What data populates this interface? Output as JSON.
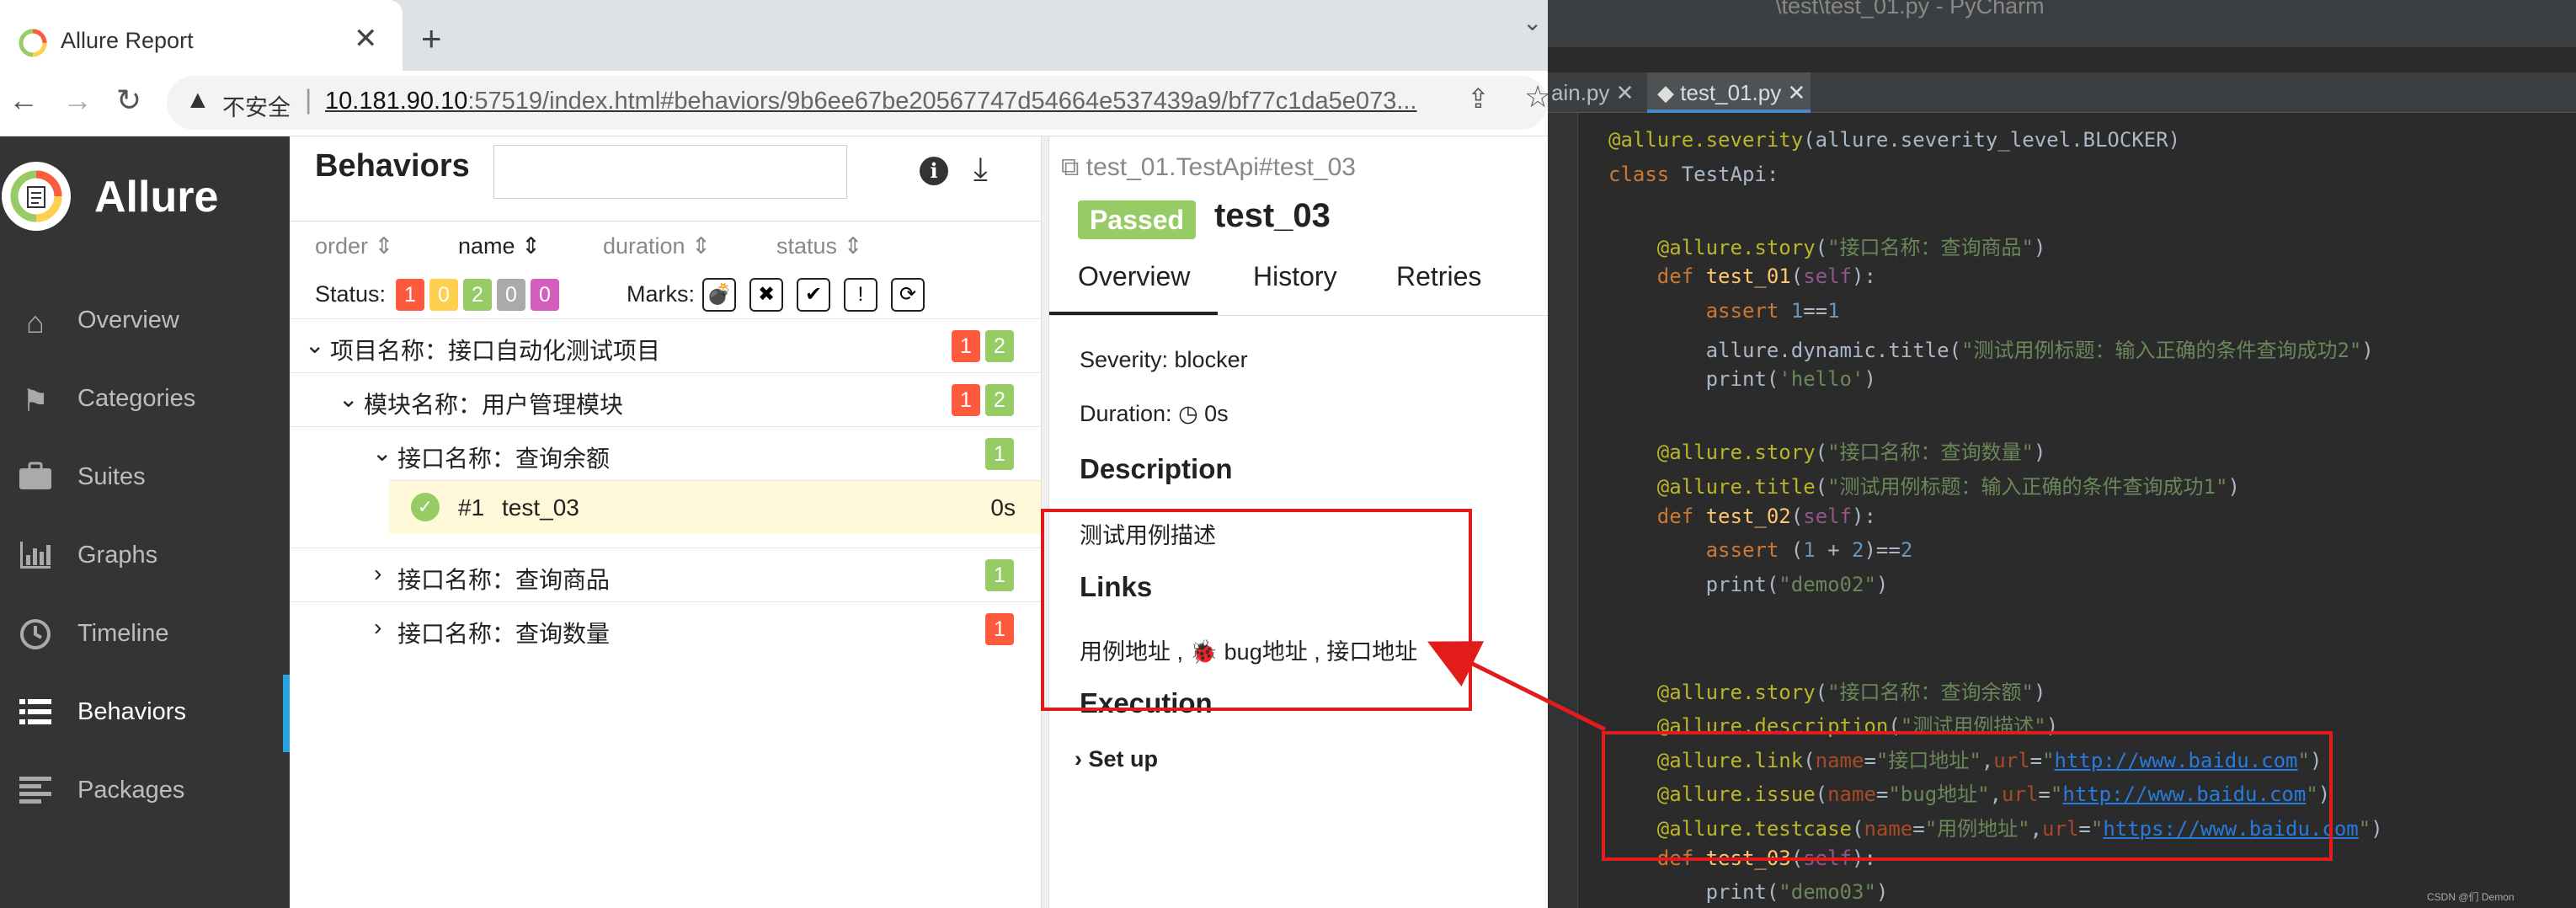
{
  "browser": {
    "tab_title": "Allure Report",
    "tab_close": "✕",
    "new_tab": "+",
    "insecure_label": "不安全",
    "url_host": "10.181.90.10",
    "url_rest": ":57519/index.html#behaviors/9b6ee67be20567747d54664e537439a9/bf77c1da5e073...",
    "win_min": "—",
    "win_max": "☐",
    "win_close": "✕",
    "win_more": "⌄"
  },
  "sidebar": {
    "brand": "Allure",
    "items": [
      {
        "label": "Overview",
        "icon": "home-icon"
      },
      {
        "label": "Categories",
        "icon": "flag-icon"
      },
      {
        "label": "Suites",
        "icon": "briefcase-icon"
      },
      {
        "label": "Graphs",
        "icon": "bar-chart-icon"
      },
      {
        "label": "Timeline",
        "icon": "clock-icon"
      },
      {
        "label": "Behaviors",
        "icon": "list-icon",
        "active": true
      },
      {
        "label": "Packages",
        "icon": "align-left-icon"
      }
    ]
  },
  "behaviors": {
    "title": "Behaviors",
    "search_placeholder": "",
    "sort_columns": [
      "order",
      "name",
      "duration",
      "status"
    ],
    "status_label": "Status:",
    "status_counts": [
      {
        "value": "1",
        "color": "#fd5a3e"
      },
      {
        "value": "0",
        "color": "#ffd050"
      },
      {
        "value": "2",
        "color": "#97cc64"
      },
      {
        "value": "0",
        "color": "#aaaaaa"
      },
      {
        "value": "0",
        "color": "#d35ebe"
      }
    ],
    "marks_label": "Marks:",
    "marks": [
      "💣",
      "✖",
      "✔",
      "!",
      "⟳"
    ],
    "tree": [
      {
        "label": "项目名称：接口自动化测试项目",
        "expanded": true,
        "counts": [
          "1",
          "2"
        ]
      },
      {
        "label": "模块名称：用户管理模块",
        "expanded": true,
        "counts": [
          "1",
          "2"
        ]
      },
      {
        "label": "接口名称：查询余额",
        "expanded": true,
        "counts": [
          "1"
        ]
      },
      {
        "leaf_num": "#1",
        "leaf_name": "test_03",
        "leaf_duration": "0s"
      },
      {
        "label": "接口名称：查询商品",
        "expanded": false,
        "counts": [
          "1"
        ]
      },
      {
        "label": "接口名称：查询数量",
        "expanded": false,
        "counts": [
          "1"
        ]
      }
    ]
  },
  "testcase": {
    "path": "test_01.TestApi#test_03",
    "status": "Passed",
    "name": "test_03",
    "tabs": [
      "Overview",
      "History",
      "Retries"
    ],
    "severity": "Severity: blocker",
    "duration_label": "Duration: ",
    "duration_value": "0s",
    "description_heading": "Description",
    "description_text": "测试用例描述",
    "links_heading": "Links",
    "link_testcase": "用例地址",
    "link_issue": "bug地址",
    "link_url": "接口地址",
    "link_sep": " , ",
    "execution_heading": "Execution",
    "setup_label": "Set up"
  },
  "pycharm": {
    "title": "\\test\\test_01.py - PyCharm",
    "tabs": [
      "ain.py",
      "test_01.py"
    ],
    "tab_close": "✕",
    "lines": [
      {
        "segs": [
          [
            "dec",
            "@allure.severity"
          ],
          [
            "",
            "(allure.severity_level.BLOCKER)"
          ]
        ]
      },
      {
        "segs": [
          [
            "kw",
            "class "
          ],
          [
            "",
            "TestApi:"
          ]
        ]
      },
      {
        "segs": []
      },
      {
        "segs": [
          [
            "dec",
            "    @allure.story"
          ],
          [
            "",
            "("
          ],
          [
            "str",
            "\"接口名称：查询商品\""
          ],
          [
            "",
            ")"
          ]
        ]
      },
      {
        "segs": [
          [
            "kw",
            "    def "
          ],
          [
            "fn",
            "test_01"
          ],
          [
            "",
            "("
          ],
          [
            "slf",
            "self"
          ],
          [
            "",
            "):"
          ]
        ]
      },
      {
        "segs": [
          [
            "kw",
            "        assert "
          ],
          [
            "num",
            "1"
          ],
          [
            "",
            "=="
          ],
          [
            "num",
            "1"
          ]
        ]
      },
      {
        "segs": [
          [
            "",
            "        allure.dynamic.title("
          ],
          [
            "str",
            "\"测试用例标题：输入正确的条件查询成功2\""
          ],
          [
            "",
            ")"
          ]
        ]
      },
      {
        "segs": [
          [
            "",
            "        print("
          ],
          [
            "str",
            "'hello'"
          ],
          [
            "",
            ")"
          ]
        ]
      },
      {
        "segs": []
      },
      {
        "segs": [
          [
            "dec",
            "    @allure.story"
          ],
          [
            "",
            "("
          ],
          [
            "str",
            "\"接口名称：查询数量\""
          ],
          [
            "",
            ")"
          ]
        ]
      },
      {
        "segs": [
          [
            "dec",
            "    @allure.title"
          ],
          [
            "",
            "("
          ],
          [
            "str",
            "\"测试用例标题：输入正确的条件查询成功1\""
          ],
          [
            "",
            ")"
          ]
        ]
      },
      {
        "segs": [
          [
            "kw",
            "    def "
          ],
          [
            "fn",
            "test_02"
          ],
          [
            "",
            "("
          ],
          [
            "slf",
            "self"
          ],
          [
            "",
            "):"
          ]
        ]
      },
      {
        "segs": [
          [
            "kw",
            "        assert "
          ],
          [
            "",
            "("
          ],
          [
            "num",
            "1"
          ],
          [
            "",
            " + "
          ],
          [
            "num",
            "2"
          ],
          [
            "",
            ")=="
          ],
          [
            "num",
            "2"
          ]
        ]
      },
      {
        "segs": [
          [
            "",
            "        print("
          ],
          [
            "str",
            "\"demo02\""
          ],
          [
            "",
            ")"
          ]
        ]
      },
      {
        "segs": []
      },
      {
        "segs": []
      },
      {
        "segs": [
          [
            "dec",
            "    @allure.story"
          ],
          [
            "",
            "("
          ],
          [
            "str",
            "\"接口名称：查询余额\""
          ],
          [
            "",
            ")"
          ]
        ]
      },
      {
        "segs": [
          [
            "dec",
            "    @allure.description"
          ],
          [
            "",
            "("
          ],
          [
            "str",
            "\"测试用例描述\""
          ],
          [
            "",
            ")"
          ]
        ]
      },
      {
        "segs": [
          [
            "dec",
            "    @allure.link"
          ],
          [
            "",
            "("
          ],
          [
            "prm",
            "name"
          ],
          [
            "",
            "="
          ],
          [
            "str",
            "\"接口地址\""
          ],
          [
            "",
            ","
          ],
          [
            "prm",
            "url"
          ],
          [
            "",
            "="
          ],
          [
            "str",
            "\""
          ],
          [
            "url",
            "http://www.baidu.com"
          ],
          [
            "str",
            "\""
          ],
          [
            "",
            ")"
          ]
        ]
      },
      {
        "segs": [
          [
            "dec",
            "    @allure.issue"
          ],
          [
            "",
            "("
          ],
          [
            "prm",
            "name"
          ],
          [
            "",
            "="
          ],
          [
            "str",
            "\"bug地址\""
          ],
          [
            "",
            ","
          ],
          [
            "prm",
            "url"
          ],
          [
            "",
            "="
          ],
          [
            "str",
            "\""
          ],
          [
            "url",
            "http://www.baidu.com"
          ],
          [
            "str",
            "\""
          ],
          [
            "",
            ")"
          ]
        ]
      },
      {
        "segs": [
          [
            "dec",
            "    @allure.testcase"
          ],
          [
            "",
            "("
          ],
          [
            "prm",
            "name"
          ],
          [
            "",
            "="
          ],
          [
            "str",
            "\"用例地址\""
          ],
          [
            "",
            ","
          ],
          [
            "prm",
            "url"
          ],
          [
            "",
            "="
          ],
          [
            "str",
            "\""
          ],
          [
            "url",
            "https://www.baidu.com"
          ],
          [
            "str",
            "\""
          ],
          [
            "",
            ")"
          ]
        ]
      },
      {
        "segs": [
          [
            "kw",
            "    def "
          ],
          [
            "fn",
            "test_03"
          ],
          [
            "",
            "("
          ],
          [
            "slf",
            "self"
          ],
          [
            "",
            "):"
          ]
        ]
      },
      {
        "segs": [
          [
            "",
            "        print("
          ],
          [
            "str",
            "\"demo03\""
          ],
          [
            "",
            ")"
          ]
        ]
      }
    ]
  },
  "watermark": "CSDN @们 Demon",
  "colors": {
    "allure_sidebar": "#343434",
    "passed": "#97cc64",
    "failed": "#fd5a3e",
    "annotation_red": "#e21b1b",
    "ide_bg": "#2b2b2b"
  }
}
